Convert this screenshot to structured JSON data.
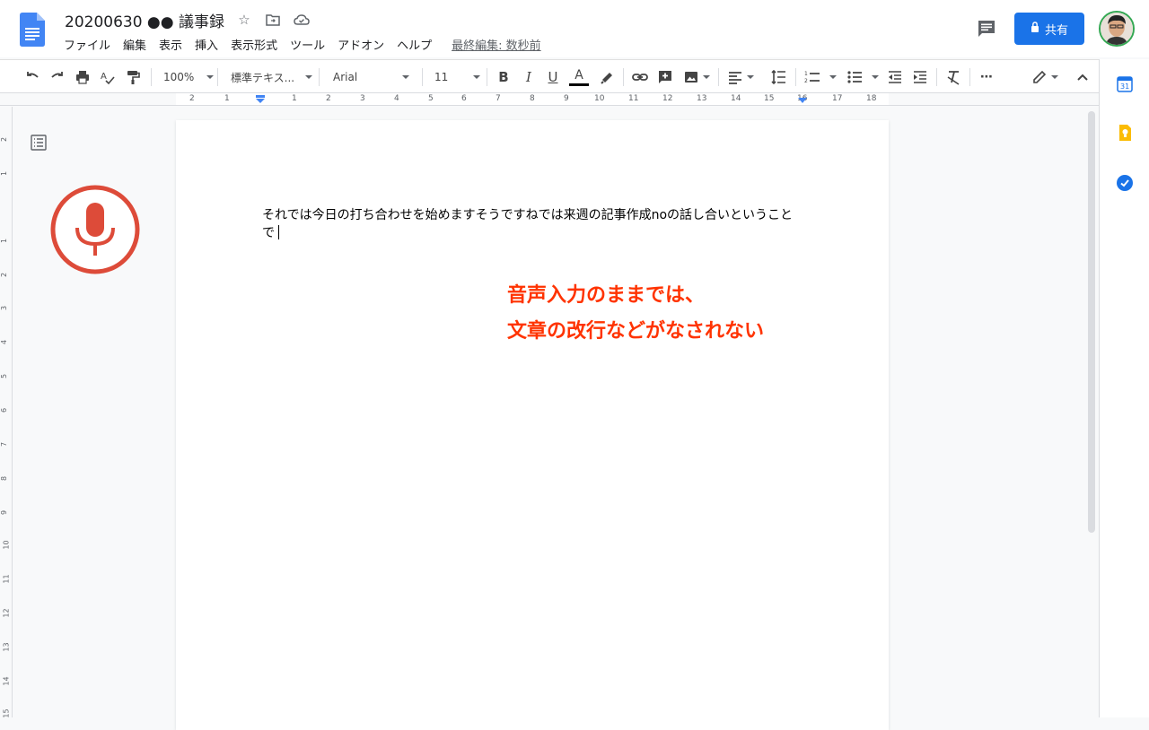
{
  "header": {
    "title": "20200630 ●● 議事録",
    "menu": [
      "ファイル",
      "編集",
      "表示",
      "挿入",
      "表示形式",
      "ツール",
      "アドオン",
      "ヘルプ"
    ],
    "last_edit": "最終編集: 数秒前",
    "share_label": "共有"
  },
  "toolbar": {
    "zoom": "100%",
    "style": "標準テキス...",
    "font": "Arial",
    "size": "11"
  },
  "ruler": {
    "numbers": [
      "2",
      "1",
      "1",
      "2",
      "3",
      "4",
      "5",
      "6",
      "7",
      "8",
      "9",
      "10",
      "11",
      "12",
      "13",
      "14",
      "15",
      "16",
      "17",
      "18"
    ]
  },
  "vruler": {
    "numbers": [
      "2",
      "1",
      "1",
      "2",
      "3",
      "4",
      "5",
      "6",
      "7",
      "8",
      "9",
      "10",
      "11",
      "12",
      "13",
      "14",
      "15"
    ]
  },
  "document": {
    "body": "それでは今日の打ち合わせを始めますそうですねでは来週の記事作成noの話し合いということで"
  },
  "annotation": {
    "line1": "音声入力のままでは、",
    "line2": "文章の改行などがなされない"
  },
  "colors": {
    "accent": "#1a73e8",
    "mic": "#dd4b39",
    "annotation": "#ff3300"
  }
}
